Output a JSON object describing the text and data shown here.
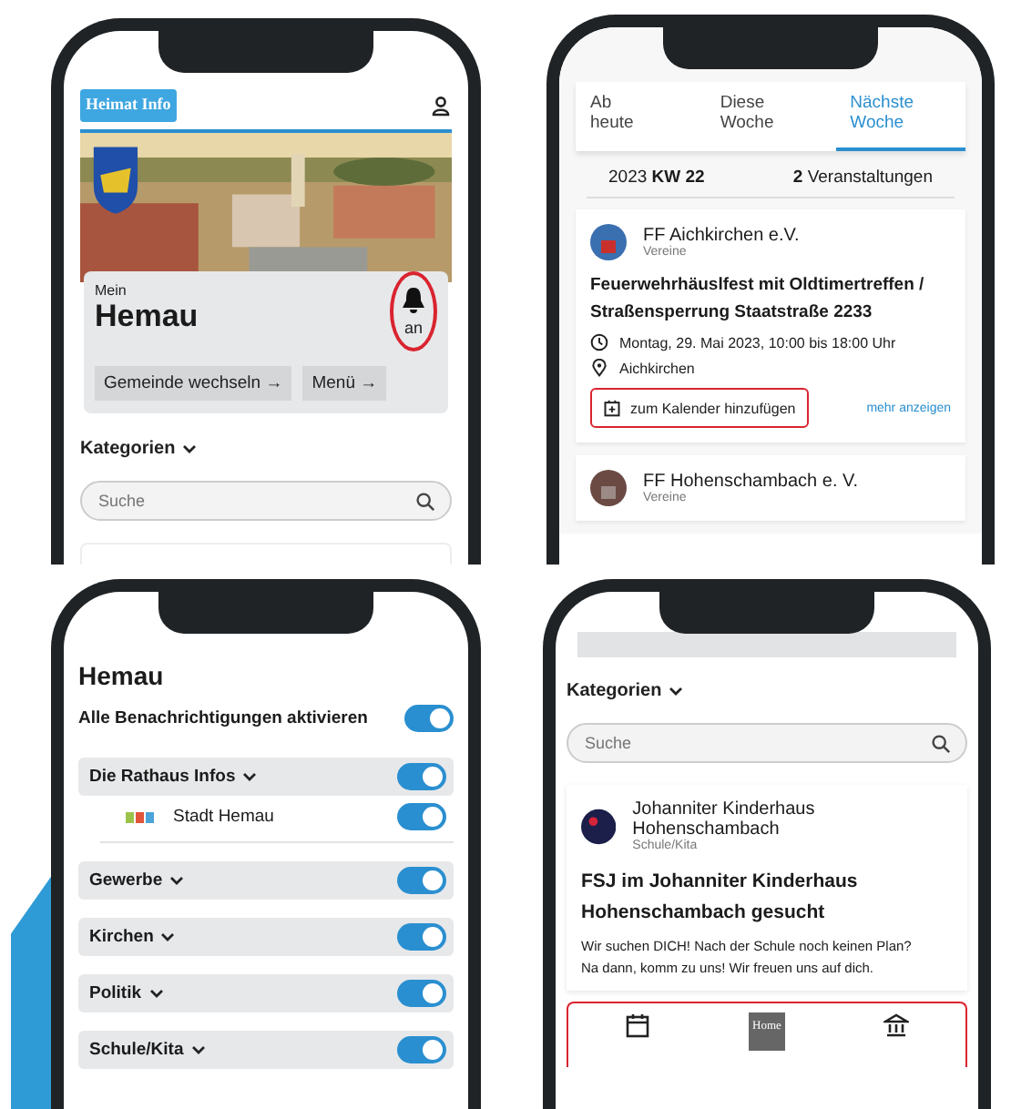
{
  "screens": [
    {
      "kind": "home",
      "logo": "Heimat Info",
      "greeting": "Mein",
      "town": "Hemau",
      "bell": {
        "label": "an",
        "on": true,
        "highlighted": true
      },
      "buttons": [
        "Gemeinde wechseln →",
        "Menü →"
      ],
      "categories": "Kategorien",
      "search": {
        "placeholder": "Suche"
      }
    },
    {
      "kind": "events",
      "tabs": [
        {
          "label": "Ab heute",
          "selected": false
        },
        {
          "label": "Diese Woche",
          "selected": false
        },
        {
          "label": "Nächste Woche",
          "selected": true
        }
      ],
      "week": "2023 **KW 22**",
      "count": "**2** Veranstaltungen",
      "events": [
        {
          "org": "FF Aichkirchen e.V.",
          "category": "Vereine",
          "title": "Feuerwehrhäuslfest mit Oldtimertreffen / Straßensperrung Staatstraße 2233",
          "date": "Montag, 29. Mai 2023, 10:00 bis 18:00 Uhr",
          "place": "Aichkirchen",
          "calendar_button": {
            "label": "zum Kalender hinzufügen",
            "highlighted": true
          },
          "more": "mehr anzeigen"
        },
        {
          "org": "FF Hohenschambach e. V.",
          "category": "Vereine"
        }
      ]
    },
    {
      "kind": "notifications",
      "title": "Hemau",
      "all": {
        "label": "Alle Benachrichtigungen aktivieren",
        "on": true
      },
      "groups": [
        {
          "label": "Die Rathaus Infos",
          "on": true,
          "children": [
            {
              "label": "Stadt Hemau",
              "on": true
            }
          ]
        },
        {
          "label": "Gewerbe",
          "on": true
        },
        {
          "label": "Kirchen",
          "on": true
        },
        {
          "label": "Politik",
          "on": true
        },
        {
          "label": "Schule/Kita",
          "on": true
        }
      ]
    },
    {
      "kind": "feed",
      "categories": "Kategorien",
      "search": {
        "placeholder": "Suche"
      },
      "post": {
        "org": "Johanniter Kinderhaus Hohenschambach",
        "category": "Schule/Kita",
        "title": "FSJ im Johanniter Kinderhaus Hohenschambach gesucht",
        "body": "Wir suchen DICH! Nach der Schule noch keinen Plan? Na dann, komm zu uns! Wir freuen uns auf dich."
      },
      "nav": {
        "home_logo": "Home",
        "highlighted": true
      }
    }
  ]
}
